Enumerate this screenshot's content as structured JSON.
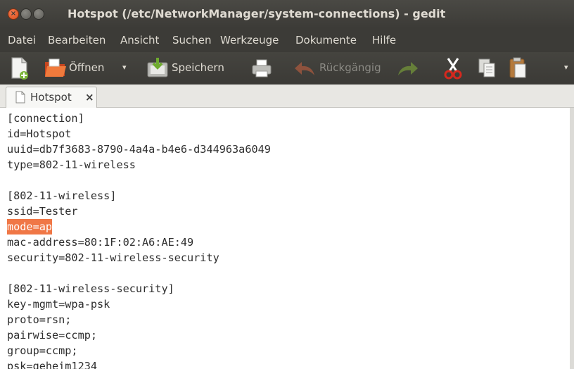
{
  "window": {
    "title": "Hotspot (/etc/NetworkManager/system-connections) - gedit"
  },
  "menu": [
    "Datei",
    "Bearbeiten",
    "Ansicht",
    "Suchen",
    "Werkzeuge",
    "Dokumente",
    "Hilfe"
  ],
  "toolbar": {
    "open_label": "Öffnen",
    "save_label": "Speichern",
    "undo_label": "Rückgängig"
  },
  "tab": {
    "label": "Hotspot",
    "close": "×"
  },
  "editor": {
    "lines": [
      "[connection]",
      "id=Hotspot",
      "uuid=db7f3683-8790-4a4a-b4e6-d344963a6049",
      "type=802-11-wireless",
      "",
      "[802-11-wireless]",
      "ssid=Tester",
      "mode=ap",
      "mac-address=80:1F:02:A6:AE:49",
      "security=802-11-wireless-security",
      "",
      "[802-11-wireless-security]",
      "key-mgmt=wpa-psk",
      "proto=rsn;",
      "pairwise=ccmp;",
      "group=ccmp;",
      "psk=geheim1234"
    ],
    "selected_line": 7
  },
  "colors": {
    "accent": "#f07746",
    "titlebar": "#3c3b37"
  }
}
